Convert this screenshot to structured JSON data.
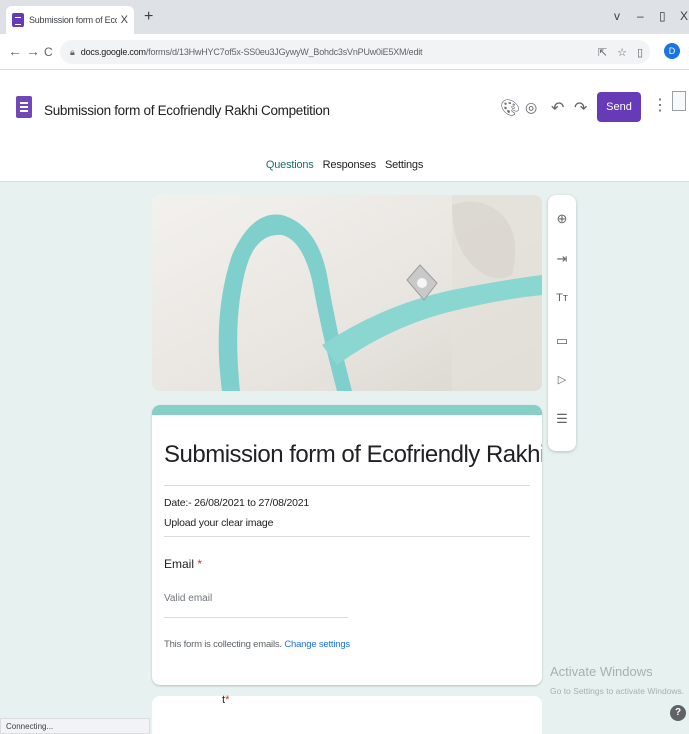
{
  "browser": {
    "tab_title": "Submission form of Ecofriendly R",
    "tab_close": "X",
    "new_tab": "+",
    "window_minimize": "v",
    "window_min2": "–",
    "window_restore": "▯",
    "window_close": "X",
    "back": "←",
    "forward": "→",
    "reload": "C",
    "url_domain": "docs.google.com",
    "url_path": "/forms/d/13HwHYC7of5x-SS0eu3JGywyW_Bohdc3sVnPUw0iE5XM/edit",
    "profile_initial": "D"
  },
  "header": {
    "doc_title": "Submission form of Ecofriendly Rakhi Competition",
    "send_label": "Send",
    "tabs": [
      {
        "label": "Questions"
      },
      {
        "label": "Responses"
      },
      {
        "label": "Settings"
      }
    ]
  },
  "form": {
    "title": "Submission form of Ecofriendly Rakhi Competition",
    "description_line1": "Date:- 26/08/2021 to 27/08/2021",
    "description_line2": "Upload your clear image",
    "email_label": "Email",
    "required_mark": "*",
    "email_placeholder": "Valid email",
    "collecting_text": "This form is collecting emails.",
    "change_settings": "Change settings",
    "next_question_fragment": "t"
  },
  "side_toolbar": {
    "icons": [
      "add-question-icon",
      "import-questions-icon",
      "add-title-icon",
      "add-image-icon",
      "add-video-icon",
      "add-section-icon"
    ],
    "title_glyph": "Tт"
  },
  "overlay": {
    "activate_title": "Activate Windows",
    "activate_sub": "Go to Settings to activate Windows.",
    "help": "?"
  },
  "status": {
    "text": "Connecting..."
  },
  "colors": {
    "theme_purple": "#673ab7",
    "teal_accent": "#86cfc7",
    "background": "#e6f1f0"
  }
}
